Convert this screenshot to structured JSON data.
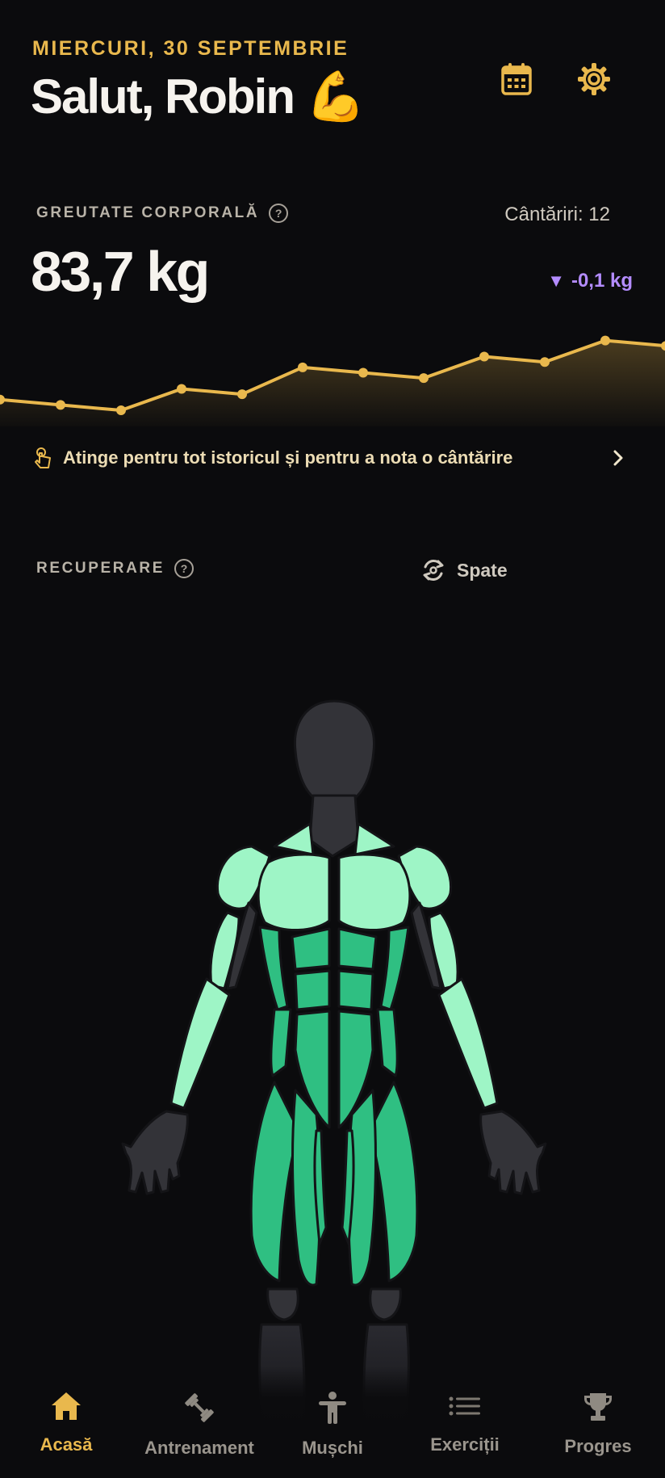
{
  "header": {
    "date": "MIERCURI, 30 SEPTEMBRIE",
    "greeting": "Salut, Robin 💪",
    "calendar_icon": "calendar-icon",
    "settings_icon": "gear-icon"
  },
  "weight": {
    "label": "GREUTATE CORPORALĂ",
    "help": "?",
    "count": "Cântăriri: 12",
    "value": "83,7 kg",
    "delta_arrow": "▼",
    "delta": "-0,1 kg",
    "accent": "#e9b84d",
    "delta_color": "#b48cff",
    "tap_hint": "Atinge pentru tot istoricul și pentru a nota o cântărire"
  },
  "chart_data": {
    "type": "line",
    "title": "",
    "xlabel": "",
    "ylabel": "",
    "grid": false,
    "x": [
      1,
      2,
      3,
      4,
      5,
      6,
      7,
      8,
      9,
      10,
      11,
      12
    ],
    "series": [
      {
        "values": [
          83.55,
          83.5,
          83.45,
          83.65,
          83.6,
          83.85,
          83.8,
          83.75,
          83.95,
          83.9,
          84.1,
          84.05
        ]
      }
    ],
    "ylim": [
      83.3,
      84.3
    ]
  },
  "recovery": {
    "label": "RECUPERARE",
    "help": "?",
    "view_toggle": "Spate",
    "view_icon": "rotate-icon",
    "fresh_color": "#9ef5c6",
    "mid_color": "#2fbf82",
    "inactive_color": "#303036"
  },
  "nav": {
    "items": [
      {
        "label": "Acasă",
        "icon": "home-icon",
        "active": true
      },
      {
        "label": "Antrenament",
        "icon": "dumbbell-icon",
        "active": false
      },
      {
        "label": "Mușchi",
        "icon": "person-icon",
        "active": false
      },
      {
        "label": "Exerciții",
        "icon": "list-icon",
        "active": false
      },
      {
        "label": "Progres",
        "icon": "trophy-icon",
        "active": false
      }
    ]
  }
}
